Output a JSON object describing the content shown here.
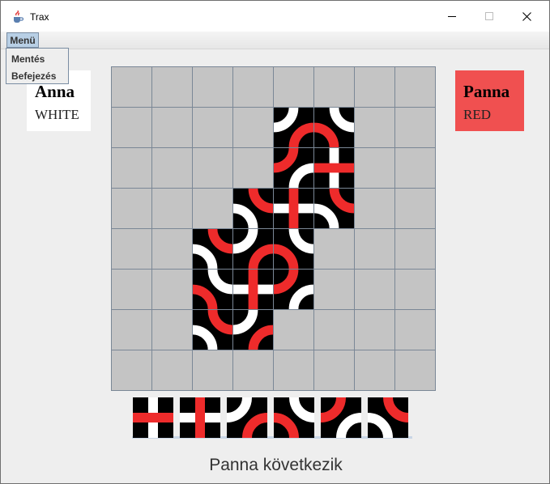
{
  "window": {
    "title": "Trax",
    "icon": "java-cup-icon"
  },
  "controls": {
    "minimize_icon": "minimize-icon",
    "maximize_icon": "maximize-icon",
    "close_icon": "close-icon"
  },
  "menu": {
    "label": "Menü",
    "items": [
      "Mentés",
      "Befejezés"
    ]
  },
  "players": [
    {
      "name": "Anna",
      "color_label": "WHITE",
      "bg": "#ffffff",
      "active": false
    },
    {
      "name": "Panna",
      "color_label": "RED",
      "bg": "#f05050",
      "active": true
    }
  ],
  "colors": {
    "red": "#ee2b2b",
    "white": "#ffffff",
    "tile_bg": "#000000",
    "empty_cell": "#c4c4c4",
    "grid_line": "#7a8796"
  },
  "board": {
    "rows": 8,
    "cols": 8,
    "tiles": [
      {
        "r": 1,
        "c": 4,
        "tile": "c0",
        "tile_description": "white curve N-W, red curve E-S"
      },
      {
        "r": 1,
        "c": 5,
        "tile": "c1",
        "tile_description": "white curve W-S, red curve N-E"
      },
      {
        "r": 2,
        "c": 4,
        "tile": "c2",
        "tile_description": "white curve N-E, red curve S-W"
      },
      {
        "r": 2,
        "c": 5,
        "tile": "x0",
        "tile_description": "white straight N-S, red straight W-E"
      },
      {
        "r": 3,
        "c": 3,
        "tile": "c3",
        "tile_description": "white curve E-S, red curve N-W"
      },
      {
        "r": 3,
        "c": 4,
        "tile": "x1",
        "tile_description": "red straight N-S, white straight W-E"
      },
      {
        "r": 3,
        "c": 5,
        "tile": "c3",
        "tile_description": "white curve N-W, red curve E-S"
      },
      {
        "r": 4,
        "c": 2,
        "tile": "c3",
        "tile_description": "white curve N-W, red curve E-S"
      },
      {
        "r": 4,
        "c": 3,
        "tile": "c0",
        "tile_description": "white curve N-E, red curve W-S"
      },
      {
        "r": 4,
        "c": 4,
        "tile": "c1",
        "tile_description": "red curve N-W, white curve E-S"
      },
      {
        "r": 5,
        "c": 2,
        "tile": "c1",
        "tile_description": "red curve N-E, white curve W-S"
      },
      {
        "r": 5,
        "c": 3,
        "tile": "x1",
        "tile_description": "white straight N-S, red straight W-E"
      },
      {
        "r": 5,
        "c": 4,
        "tile": "c2",
        "tile_description": "white curve N-E, red curve W-S"
      },
      {
        "r": 6,
        "c": 2,
        "tile": "c3",
        "tile_description": "white curve N-W, red curve E-S"
      },
      {
        "r": 6,
        "c": 3,
        "tile": "c0",
        "tile_description": "red curve N-E, white curve W-S"
      }
    ]
  },
  "hand": [
    "x0",
    "x1",
    "c0",
    "c1",
    "c2",
    "c3"
  ],
  "status": "Panna következik"
}
